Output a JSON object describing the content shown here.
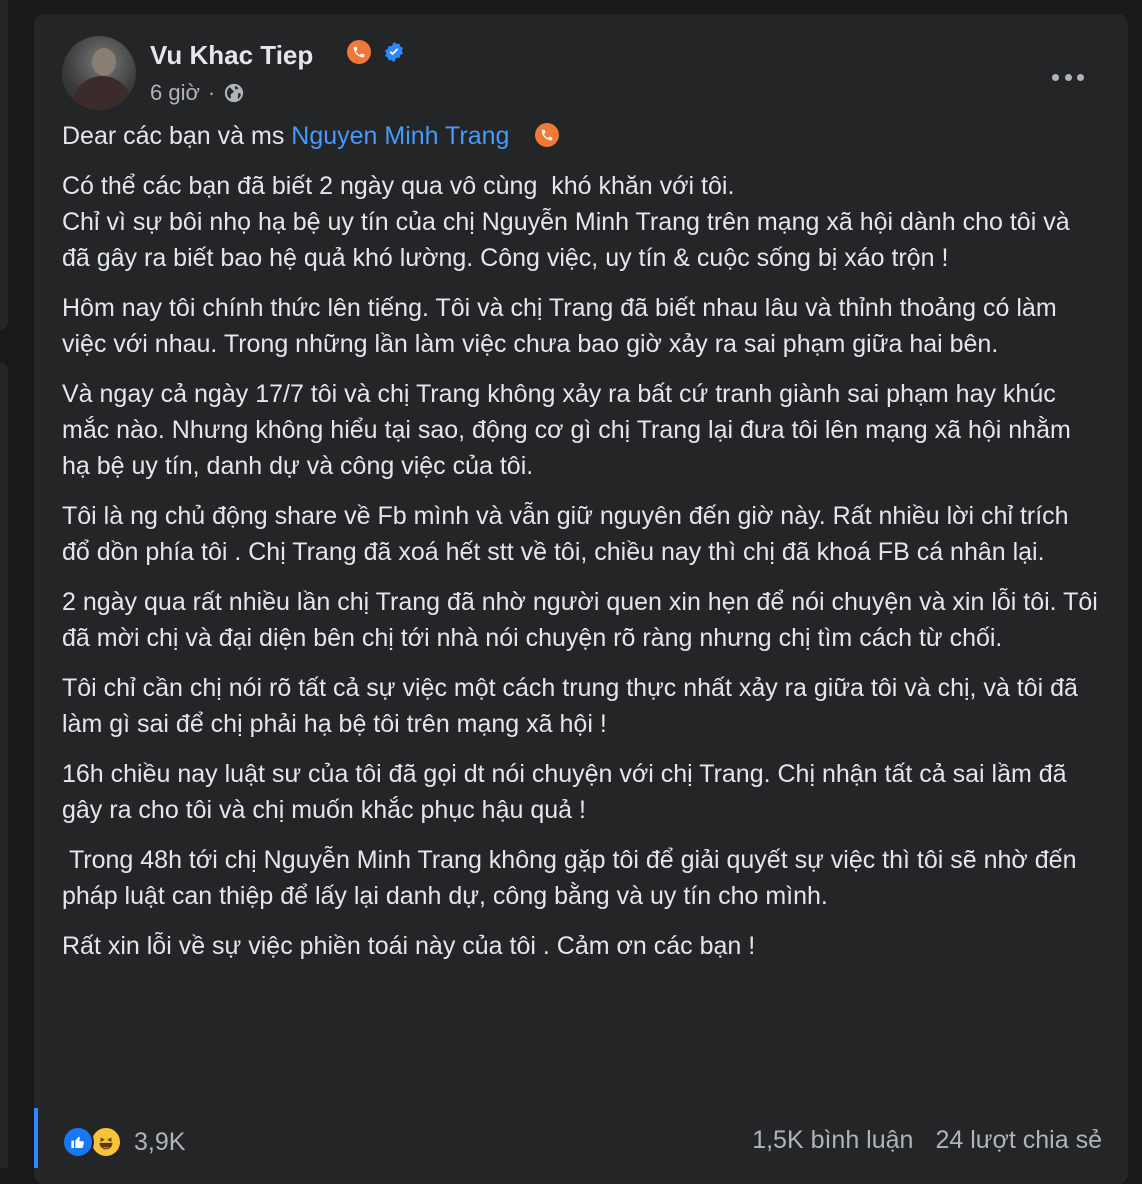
{
  "post": {
    "author": "Vu Khac Tiep",
    "time": "6 giờ",
    "separator": "·",
    "paragraphs": {
      "p0_prefix": "Dear các bạn và ms ",
      "p0_mention": "Nguyen Minh Trang",
      "p1": "Có thể các bạn đã biết 2 ngày qua vô cùng  khó khăn với tôi.\nChỉ vì sự bôi nhọ hạ bệ uy tín của chị Nguyễn Minh Trang trên mạng xã hội dành cho tôi và đã gây ra biết bao hệ quả khó lường. Công việc, uy tín & cuộc sống bị xáo trộn !",
      "p2": "Hôm nay tôi chính thức lên tiếng. Tôi và chị Trang đã biết nhau lâu và thỉnh thoảng có làm việc với nhau. Trong những lần làm việc chưa bao giờ xảy ra sai phạm giữa hai bên.",
      "p3": "Và ngay cả ngày 17/7 tôi và chị Trang không xảy ra bất cứ tranh giành sai phạm hay khúc mắc nào. Nhưng không hiểu tại sao, động cơ gì chị Trang lại đưa tôi lên mạng xã hội nhằm hạ bệ uy tín, danh dự và công việc của tôi.",
      "p4": "Tôi là ng chủ động share về Fb mình và vẫn giữ nguyên đến giờ này. Rất nhiều lời chỉ trích đổ dồn phía tôi . Chị Trang đã xoá hết stt về tôi, chiều nay thì chị đã khoá FB cá nhân lại.",
      "p5": "2 ngày qua rất nhiều lần chị Trang đã nhờ người quen xin hẹn để nói chuyện và xin lỗi tôi. Tôi đã mời chị và đại diện bên chị tới nhà nói chuyện rõ ràng nhưng chị tìm cách từ chối.",
      "p6": "Tôi chỉ cần chị nói rõ tất cả sự việc một cách trung thực nhất xảy ra giữa tôi và chị, và tôi đã làm gì sai để chị phải hạ bệ tôi trên mạng xã hội !",
      "p7": "16h chiều nay luật sư của tôi đã gọi dt nói chuyện với chị Trang. Chị nhận tất cả sai lầm đã gây ra cho tôi và chị muốn khắc phục hậu quả !",
      "p8": " Trong 48h tới chị Nguyễn Minh Trang không gặp tôi để giải quyết sự việc thì tôi sẽ nhờ đến pháp luật can thiệp để lấy lại danh dự, công bằng và uy tín cho mình.",
      "p9": "Rất xin lỗi về sự việc phiền toái này của tôi . Cảm ơn các bạn !"
    },
    "reactions_count": "3,9K",
    "comments": "1,5K bình luận",
    "shares": "24 lượt chia sẻ"
  },
  "icons": {
    "phone": "phone-icon",
    "verified": "verified-badge-icon",
    "globe": "globe-icon",
    "more": "more-options-icon",
    "like": "like-reaction-icon",
    "haha": "haha-reaction-icon"
  },
  "colors": {
    "background": "#18191a",
    "card": "#242526",
    "text": "#e4e6eb",
    "secondary_text": "#b0b3b8",
    "mention": "#4599ff",
    "phone_badge": "#f07838",
    "verified": "#2d88ff"
  }
}
